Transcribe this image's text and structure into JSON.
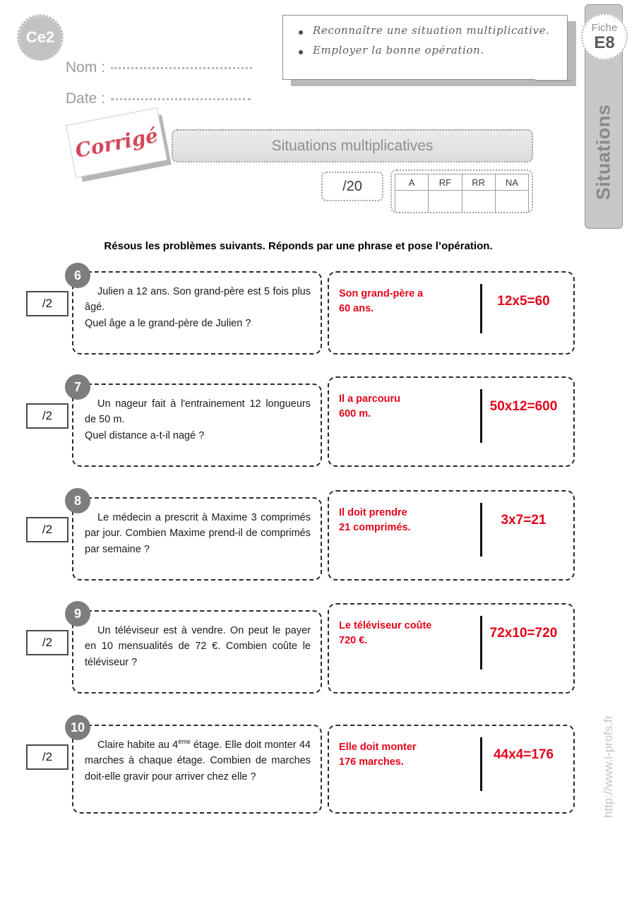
{
  "header": {
    "level_badge": "Ce2",
    "name_label": "Nom :",
    "date_label": "Date :",
    "fiche_label": "Fiche",
    "fiche_code": "E8",
    "sidebar_label": "Situations",
    "url": "http://www.i-profs.fr",
    "corrige_label": "Corrigé",
    "title": "Situations multiplicatives",
    "score": "/20",
    "objectives": [
      "Reconnaître une situation multiplicative.",
      "Employer la bonne opération."
    ],
    "eval_headers": [
      "A",
      "RF",
      "RR",
      "NA"
    ]
  },
  "instruction": "Résous les problèmes suivants. Réponds par une phrase et pose l’opération.",
  "exercises": [
    {
      "number": "6",
      "points": "/2",
      "question_line1": "Julien a 12 ans. Son grand-père est 5 fois plus âgé.",
      "question_line2": "Quel âge a le grand-père de Julien ?",
      "answer_line1": "Son grand-père a",
      "answer_line2": "60 ans.",
      "operation": "12x5=60"
    },
    {
      "number": "7",
      "points": "/2",
      "question_line1": "Un nageur fait à l'entrainement 12 longueurs de 50 m.",
      "question_line2": "Quel distance a-t-il nagé ?",
      "answer_line1": "Il a parcouru",
      "answer_line2": "600 m.",
      "operation": "50x12=600"
    },
    {
      "number": "8",
      "points": "/2",
      "question_line1": "Le médecin a prescrit à Maxime 3 comprimés par jour. Combien Maxime prend-il de comprimés par semaine ?",
      "question_line2": "",
      "answer_line1": "Il doit prendre",
      "answer_line2": "21 comprimés.",
      "operation": "3x7=21"
    },
    {
      "number": "9",
      "points": "/2",
      "question_line1": "Un téléviseur est à vendre. On peut le payer en 10 mensualités de 72 €.",
      "question_line2": "Combien coûte le téléviseur ?",
      "answer_line1": "Le téléviseur coûte",
      "answer_line2": "720 €.",
      "operation": "72x10=720"
    },
    {
      "number": "10",
      "points": "/2",
      "question_prefix": "Claire habite au 4",
      "question_sup": "ème",
      "question_suffix": " étage. Elle doit monter 44 marches à chaque étage. Combien de marches doit-elle gravir pour arriver chez elle ?",
      "answer_line1": "Elle doit monter",
      "answer_line2": "176 marches.",
      "operation": "44x4=176"
    }
  ],
  "colors": {
    "answer_red": "#e3051b",
    "gray_bar": "#c8c8c8",
    "badge_gray": "#7d7d7d"
  }
}
